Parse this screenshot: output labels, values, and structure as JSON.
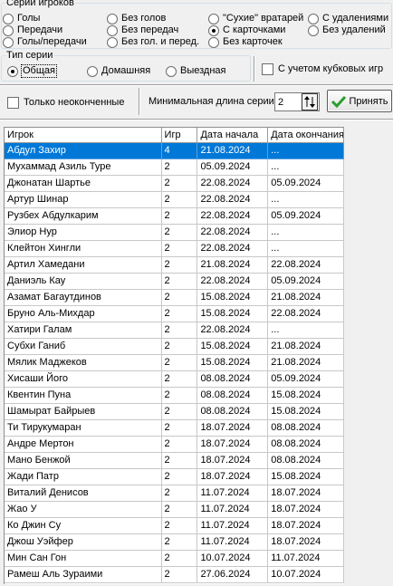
{
  "series": {
    "legend": "Серии игроков",
    "options": [
      "Голы",
      "Передачи",
      "Голы/передачи",
      "Без голов",
      "Без передач",
      "Без гол. и перед.",
      "\"Сухие\" вратарей",
      "С карточками",
      "Без карточек",
      "С удалениями",
      "Без удалений"
    ],
    "selected": "С карточками"
  },
  "type": {
    "legend": "Тип серии",
    "options": [
      "Общая",
      "Домашняя",
      "Выездная"
    ],
    "selected": "Общая"
  },
  "cup_games_label": "С учетом кубковых игр",
  "unfinished_label": "Только неоконченные",
  "min_length_label": "Минимальная длина серии",
  "min_length_value": "2",
  "accept_label": "Принять",
  "colors": {
    "selection": "#0078d7",
    "accept_check": "#2c9e2c"
  },
  "table": {
    "columns": [
      "Игрок",
      "Игр",
      "Дата начала",
      "Дата окончания"
    ],
    "rows": [
      [
        "Абдул Захир",
        "4",
        "21.08.2024",
        "..."
      ],
      [
        "Мухаммад Азиль Туре",
        "2",
        "05.09.2024",
        "..."
      ],
      [
        "Джонатан Шартье",
        "2",
        "22.08.2024",
        "05.09.2024"
      ],
      [
        "Артур Шинар",
        "2",
        "22.08.2024",
        "..."
      ],
      [
        "Рузбех Абдулкарим",
        "2",
        "22.08.2024",
        "05.09.2024"
      ],
      [
        "Элиор Нур",
        "2",
        "22.08.2024",
        "..."
      ],
      [
        "Клейтон Хингли",
        "2",
        "22.08.2024",
        "..."
      ],
      [
        "Артил Хамедани",
        "2",
        "21.08.2024",
        "22.08.2024"
      ],
      [
        "Даниэль Кау",
        "2",
        "22.08.2024",
        "05.09.2024"
      ],
      [
        "Азамат Багаутдинов",
        "2",
        "15.08.2024",
        "21.08.2024"
      ],
      [
        "Бруно Аль-Михдар",
        "2",
        "15.08.2024",
        "22.08.2024"
      ],
      [
        "Хатири Галам",
        "2",
        "22.08.2024",
        "..."
      ],
      [
        "Субхи Ганиб",
        "2",
        "15.08.2024",
        "21.08.2024"
      ],
      [
        "Мялик Маджеков",
        "2",
        "15.08.2024",
        "21.08.2024"
      ],
      [
        "Хисаши Його",
        "2",
        "08.08.2024",
        "05.09.2024"
      ],
      [
        "Квентин Пуна",
        "2",
        "08.08.2024",
        "15.08.2024"
      ],
      [
        "Шамырат Байрыев",
        "2",
        "08.08.2024",
        "15.08.2024"
      ],
      [
        "Ти Тирукумаран",
        "2",
        "18.07.2024",
        "08.08.2024"
      ],
      [
        "Андре Мертон",
        "2",
        "18.07.2024",
        "08.08.2024"
      ],
      [
        "Мано Бенжой",
        "2",
        "18.07.2024",
        "08.08.2024"
      ],
      [
        "Жади Патр",
        "2",
        "18.07.2024",
        "15.08.2024"
      ],
      [
        "Виталий Денисов",
        "2",
        "11.07.2024",
        "18.07.2024"
      ],
      [
        "Жао У",
        "2",
        "11.07.2024",
        "18.07.2024"
      ],
      [
        "Ко Джин Су",
        "2",
        "11.07.2024",
        "18.07.2024"
      ],
      [
        "Джош Уэйфер",
        "2",
        "11.07.2024",
        "18.07.2024"
      ],
      [
        "Мин Сан Гон",
        "2",
        "10.07.2024",
        "11.07.2024"
      ],
      [
        "Рамеш Аль Зураими",
        "2",
        "27.06.2024",
        "10.07.2024"
      ]
    ]
  }
}
